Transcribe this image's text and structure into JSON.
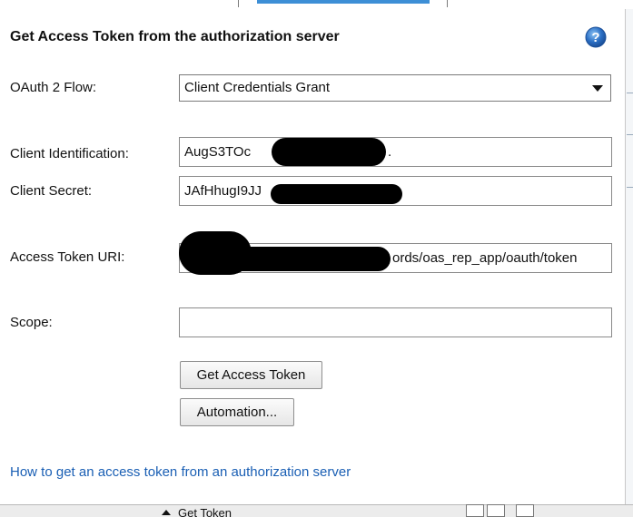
{
  "dialog": {
    "title": "Get Access Token from the authorization server",
    "help_icon": "help-icon"
  },
  "oauth_flow": {
    "label": "OAuth 2 Flow:",
    "selected": "Client Credentials Grant"
  },
  "client_id": {
    "label": "Client Identification:",
    "value": "AugS3TOc",
    "value_tail": "."
  },
  "client_secret": {
    "label": "Client Secret:",
    "value": "JAfHhugI9JJ"
  },
  "access_token_uri": {
    "label": "Access Token URI:",
    "value": "ords/oas_rep_app/oauth/token"
  },
  "scope": {
    "label": "Scope:",
    "value": ""
  },
  "buttons": {
    "get_access_token": "Get Access Token",
    "automation": "Automation..."
  },
  "help_link": "How to get an access token from an authorization server",
  "footer": {
    "get_token": "Get Token"
  },
  "colors": {
    "link": "#1a5fb4",
    "help_icon": "#2b6fc4",
    "accent_tab": "#3d8fd6"
  }
}
